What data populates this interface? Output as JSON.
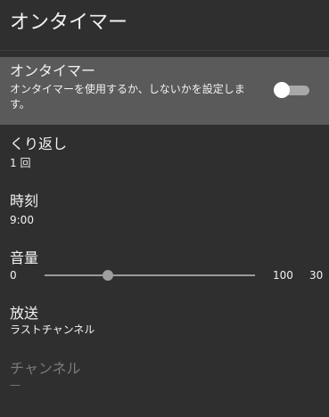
{
  "header": {
    "title": "オンタイマー"
  },
  "on_timer": {
    "title": "オンタイマー",
    "description": "オンタイマーを使用するか、しないかを設定します。",
    "enabled": false
  },
  "repeat": {
    "title": "くり返し",
    "value": "1 回"
  },
  "time": {
    "title": "時刻",
    "value": "9:00"
  },
  "volume": {
    "title": "音量",
    "min_label": "0",
    "max_label": "100",
    "value": "30",
    "level": 30
  },
  "broadcast": {
    "title": "放送",
    "value": "ラストチャンネル"
  },
  "channel": {
    "title": "チャンネル",
    "value": "—"
  }
}
